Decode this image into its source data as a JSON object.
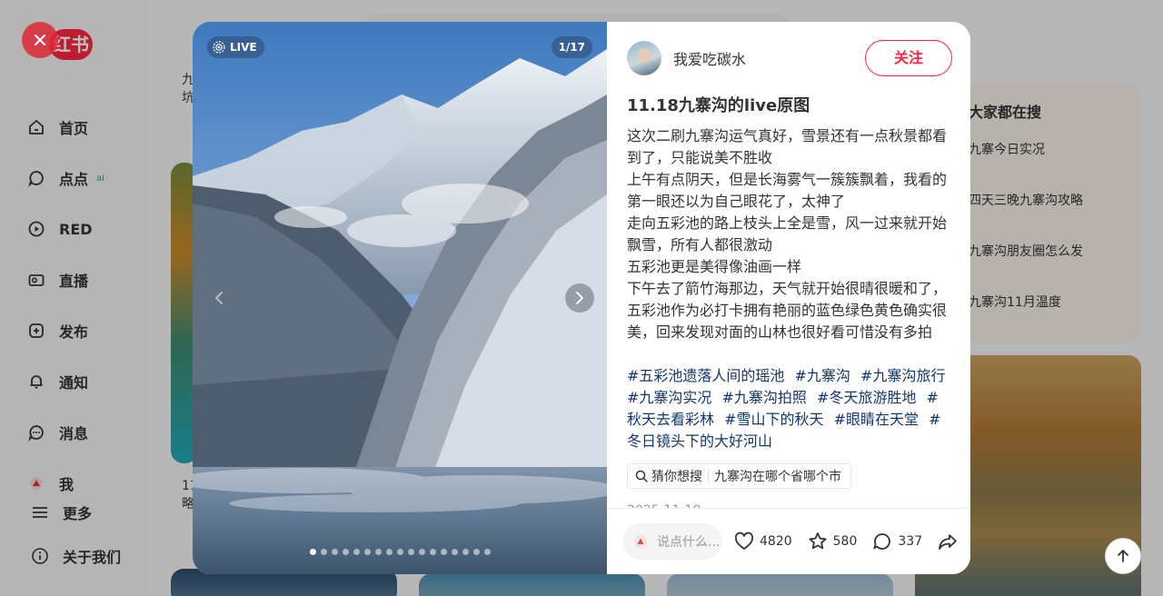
{
  "sidebar": {
    "logo": "红书",
    "items": [
      {
        "label": "首页",
        "icon": "home-icon"
      },
      {
        "label": "点点",
        "icon": "chat-bubble-icon",
        "badge": "ai"
      },
      {
        "label": "RED",
        "icon": "play-circle-icon"
      },
      {
        "label": "直播",
        "icon": "live-camera-icon"
      },
      {
        "label": "发布",
        "icon": "plus-square-icon"
      },
      {
        "label": "通知",
        "icon": "bell-icon"
      },
      {
        "label": "消息",
        "icon": "message-icon"
      },
      {
        "label": "我",
        "icon": "avatar-icon"
      },
      {
        "label": "更多",
        "icon": "menu-icon"
      },
      {
        "label": "关于我们",
        "icon": "info-icon"
      }
    ]
  },
  "background_feed": {
    "title_1": "九",
    "title_1b": "坑",
    "title_2": "11",
    "title_2b": "略"
  },
  "hot_searches": {
    "title": "大家都在搜",
    "items": [
      "九寨今日实况",
      "四天三晚九寨沟攻略",
      "九寨沟朋友圈怎么发",
      "九寨沟11月温度"
    ]
  },
  "media": {
    "live_label": "LIVE",
    "page_counter": "1/17",
    "total_images": 17,
    "current_index": 1
  },
  "note": {
    "author": "我爱吃碳水",
    "follow_label": "关注",
    "title": "11.18九寨沟的live原图",
    "lines": [
      "这次二刷九寨沟运气真好，雪景还有一点秋景都看到了，只能说美不胜收",
      "上午有点阴天，但是长海雾气一簇簇飘着，我看的第一眼还以为自己眼花了，太神了",
      "走向五彩池的路上枝头上全是雪，风一过来就开始飘雪，所有人都很激动",
      "五彩池更是美得像油画一样",
      "下午去了箭竹海那边，天气就开始很晴很暖和了，五彩池作为必打卡拥有艳丽的蓝色绿色黄色确实很美，回来发现对面的山林也很好看可惜没有多拍"
    ],
    "tags": [
      "#五彩池遗落人间的瑶池",
      "#九寨沟",
      "#九寨沟旅行",
      "#九寨沟实况",
      "#九寨沟拍照",
      "#冬天旅游胜地",
      "#秋天去看彩林",
      "#雪山下的秋天",
      "#眼睛在天堂",
      "#冬日镜头下的大好河山"
    ],
    "guess_label": "猜你想搜",
    "guess_query": "九寨沟在哪个省哪个市",
    "date": "2025-11-18"
  },
  "engagement": {
    "comment_placeholder": "说点什么...",
    "likes": "4820",
    "collects": "580",
    "comments": "337"
  },
  "colors": {
    "brand": "#ff2442",
    "tag": "#13386c"
  }
}
